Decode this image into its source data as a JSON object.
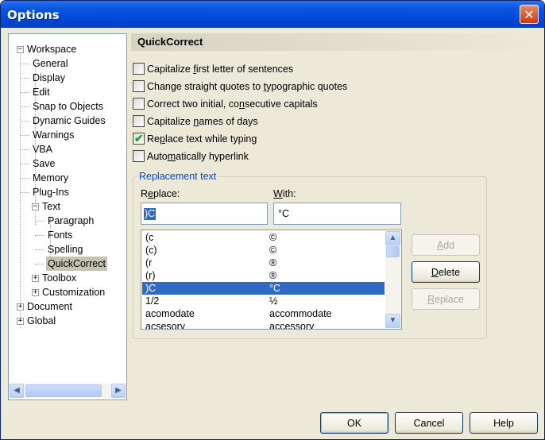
{
  "window": {
    "title": "Options"
  },
  "tree": {
    "items": [
      {
        "label": "Workspace",
        "expander": "−"
      },
      {
        "label": "General"
      },
      {
        "label": "Display"
      },
      {
        "label": "Edit"
      },
      {
        "label": "Snap to Objects"
      },
      {
        "label": "Dynamic Guides"
      },
      {
        "label": "Warnings"
      },
      {
        "label": "VBA"
      },
      {
        "label": "Save"
      },
      {
        "label": "Memory"
      },
      {
        "label": "Plug-Ins"
      },
      {
        "label": "Text",
        "expander": "−"
      },
      {
        "label": "Paragraph"
      },
      {
        "label": "Fonts"
      },
      {
        "label": "Spelling"
      },
      {
        "label": "QuickCorrect",
        "selected": true
      },
      {
        "label": "Toolbox",
        "expander": "+"
      },
      {
        "label": "Customization",
        "expander": "+"
      },
      {
        "label": "Document",
        "expander": "+"
      },
      {
        "label": "Global",
        "expander": "+"
      }
    ]
  },
  "panel": {
    "title": "QuickCorrect",
    "options": [
      {
        "pre": "Capitalize ",
        "key": "f",
        "post": "irst letter of sentences",
        "checked": false
      },
      {
        "pre": "Change straight quotes to ",
        "key": "t",
        "post": "ypographic quotes",
        "checked": false
      },
      {
        "pre": "Correct two initial, co",
        "key": "n",
        "post": "secutive capitals",
        "checked": false
      },
      {
        "pre": "Capitalize ",
        "key": "n",
        "post": "ames of days",
        "checked": false
      },
      {
        "pre": "Re",
        "key": "p",
        "post": "lace text while typing",
        "checked": true
      },
      {
        "pre": "Auto",
        "key": "m",
        "post": "atically hyperlink",
        "checked": false
      }
    ],
    "replacement": {
      "legend": "Replacement text",
      "replace_label_pre": "R",
      "replace_label_key": "e",
      "replace_label_post": "place:",
      "with_label_key": "W",
      "with_label_post": "ith:",
      "replace_value": ")C",
      "with_value": "°C",
      "entries": [
        {
          "replace": "(c",
          "with": "©"
        },
        {
          "replace": "(c)",
          "with": "©"
        },
        {
          "replace": "(r",
          "with": "®"
        },
        {
          "replace": "(r)",
          "with": "®"
        },
        {
          "replace": ")C",
          "with": "°C",
          "selected": true
        },
        {
          "replace": "1/2",
          "with": "½"
        },
        {
          "replace": "acomodate",
          "with": "accommodate"
        },
        {
          "replace": "acsesory",
          "with": "accessory"
        }
      ]
    },
    "buttons": {
      "add_key": "A",
      "add_post": "dd",
      "delete_key": "D",
      "delete_post": "elete",
      "replace_key": "R",
      "replace_post": "eplace"
    }
  },
  "footer": {
    "ok": "OK",
    "cancel": "Cancel",
    "help": "Help"
  },
  "colors": {
    "title_bar": "#0a55e0",
    "close_button": "#c63a15",
    "selection": "#316ac5",
    "check": "#21a121",
    "group_legend": "#0046d5"
  }
}
